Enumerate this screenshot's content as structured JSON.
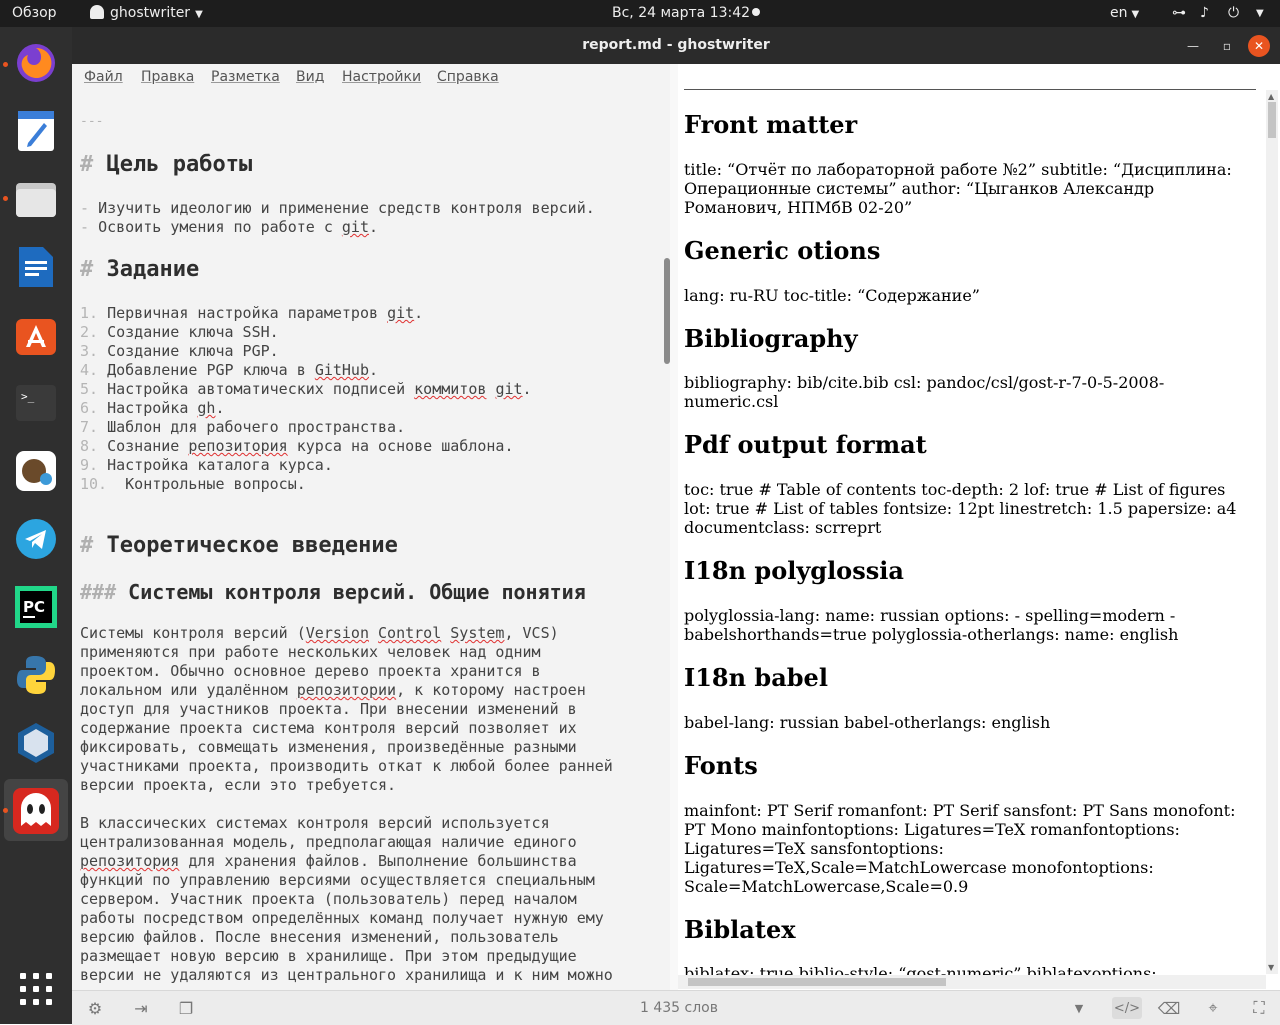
{
  "topbar": {
    "overview": "Обзор",
    "app_name": "ghostwriter",
    "datetime": "Вс, 24 марта  13:42",
    "lang": "en"
  },
  "window": {
    "title": "report.md - ghostwriter"
  },
  "menu": [
    "Файл",
    "Правка",
    "Разметка",
    "Вид",
    "Настройки",
    "Справка"
  ],
  "editor": {
    "front_rule": "---",
    "h1_goal": "Цель работы",
    "goal_items": [
      "Изучить идеологию и применение средств контроля версий.",
      "Освоить умения по работе с git."
    ],
    "h1_task": "Задание",
    "task_items": [
      {
        "n": "1.",
        "text": "Первичная настройка параметров git."
      },
      {
        "n": "2.",
        "text": "Создание ключа SSH."
      },
      {
        "n": "3.",
        "text": "Создание ключа PGP."
      },
      {
        "n": "4.",
        "text": "Добавление PGP ключа в GitHub."
      },
      {
        "n": "5.",
        "text": "Настройка автоматических подписей коммитов git."
      },
      {
        "n": "6.",
        "text": "Настройка gh."
      },
      {
        "n": "7.",
        "text": "Шаблон для рабочего пространства."
      },
      {
        "n": "8.",
        "text": "Сознание репозитория курса на основе шаблона."
      },
      {
        "n": "9.",
        "text": "Настройка каталога курса."
      },
      {
        "n": "10.",
        "text": " Контрольные вопросы."
      }
    ],
    "h1_theory": "Теоретическое введение",
    "h3_vcs": "Системы контроля версий. Общие понятия",
    "para1": [
      "Системы контроля версий (Version Control System, VCS)",
      "применяются при работе нескольких человек над одним",
      "проектом. Обычно основное дерево проекта хранится в",
      "локальном или удалённом репозитории, к которому настроен",
      "доступ для участников проекта. При внесении изменений в",
      "содержание проекта система контроля версий позволяет их",
      "фиксировать, совмещать изменения, произведённые разными",
      "участниками проекта, производить откат к любой более ранней",
      "версии проекта, если это требуется."
    ],
    "para2": [
      "В классических системах контроля версий используется",
      "централизованная модель, предполагающая наличие единого",
      "репозитория для хранения файлов. Выполнение большинства",
      "функций по управлению версиями осуществляется специальным",
      "сервером. Участник проекта (пользователь) перед началом",
      "работы посредством определённых команд получает нужную ему",
      "версию файлов. После внесения изменений, пользователь",
      "размещает новую версию в хранилище. При этом предыдущие",
      "версии не удаляются из центрального хранилища и к ним можно"
    ]
  },
  "preview": {
    "sections": [
      {
        "heading": "Front matter",
        "text": "title: “Отчёт по лабораторной работе №2” subtitle: “Дисциплина: Операционные системы” author: “Цыганков Александр Романович, НПМбВ 02-20”"
      },
      {
        "heading": "Generic otions",
        "text": "lang: ru-RU toc-title: “Содержание”"
      },
      {
        "heading": "Bibliography",
        "text": "bibliography: bib/cite.bib csl: pandoc/csl/gost-r-7-0-5-2008-numeric.csl"
      },
      {
        "heading": "Pdf output format",
        "text": "toc: true # Table of contents toc-depth: 2 lof: true # List of figures lot: true # List of tables fontsize: 12pt linestretch: 1.5 papersize: a4 documentclass: scrreprt"
      },
      {
        "heading": "I18n polyglossia",
        "text": "polyglossia-lang: name: russian options: - spelling=modern - babelshorthands=true polyglossia-otherlangs: name: english"
      },
      {
        "heading": "I18n babel",
        "text": "babel-lang: russian babel-otherlangs: english"
      },
      {
        "heading": "Fonts",
        "text": "mainfont: PT Serif romanfont: PT Serif sansfont: PT Sans monofont: PT Mono mainfontoptions: Ligatures=TeX romanfontoptions: Ligatures=TeX sansfontoptions: Ligatures=TeX,Scale=MatchLowercase monofontoptions: Scale=MatchLowercase,Scale=0.9"
      },
      {
        "heading": "Biblatex",
        "text": "biblatex: true biblio-style: “gost-numeric” biblatexoptions:"
      }
    ]
  },
  "status": {
    "word_count": "1 435 слов"
  },
  "dock": [
    "firefox-icon",
    "text-editor-icon",
    "files-icon",
    "writer-icon",
    "software-center-icon",
    "terminal-icon",
    "squirrel-icon",
    "telegram-icon",
    "pycharm-icon",
    "python-icon",
    "virtualbox-icon",
    "ghostwriter-icon",
    "app-grid-icon"
  ],
  "colors": {
    "accent": "#e95420",
    "topbar": "#1d1d1d",
    "dock": "#2f2f2f",
    "editor_bg": "#f3f3f3"
  }
}
